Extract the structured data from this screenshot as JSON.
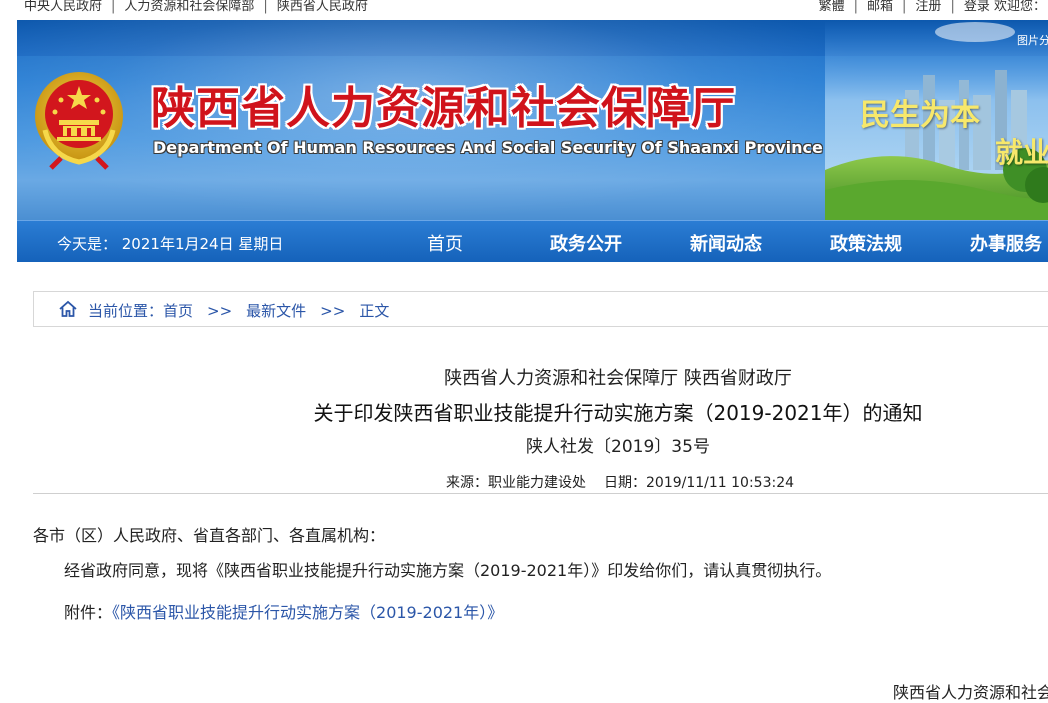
{
  "topbar": {
    "links_left": [
      "中央人民政府",
      "人力资源和社会保障部",
      "陕西省人民政府"
    ],
    "links_right": [
      "繁體",
      "邮箱",
      "注册",
      "登录"
    ],
    "welcome": "欢迎您："
  },
  "banner": {
    "title": "陕西省人力资源和社会保障厅",
    "subtitle": "Department Of Human Resources And Social Security Of Shaanxi Province",
    "slogan_1": "民生为本",
    "slogan_2": "就业",
    "image_tag": "图片分"
  },
  "nav": {
    "date": "今天是：  2021年1月24日 星期日",
    "items": [
      "首页",
      "政务公开",
      "新闻动态",
      "政策法规",
      "办事服务"
    ]
  },
  "breadcrumb": {
    "items": [
      "当前位置：首页",
      "最新文件",
      "正文"
    ],
    "separator": ">>"
  },
  "article": {
    "issuer": "陕西省人力资源和社会保障厅 陕西省财政厅",
    "title": "关于印发陕西省职业技能提升行动实施方案（2019-2021年）的通知",
    "doc_number": "陕人社发〔2019〕35号",
    "source": "来源：职业能力建设处",
    "date": "日期：2019/11/11 10:53:24",
    "salutation": "各市（区）人民政府、省直各部门、各直属机构：",
    "paragraph": "经省政府同意，现将《陕西省职业技能提升行动实施方案（2019-2021年）》印发给你们，请认真贯彻执行。",
    "attachment_label": "附件：",
    "attachment_link": "《陕西省职业技能提升行动实施方案（2019-2021年）》",
    "signature": "陕西省人力资源和社会"
  },
  "colors": {
    "title_red": "#d0131b",
    "nav_blue": "#1562ba",
    "link_blue": "#2b56a8",
    "slogan_yellow": "#f7e86b"
  }
}
